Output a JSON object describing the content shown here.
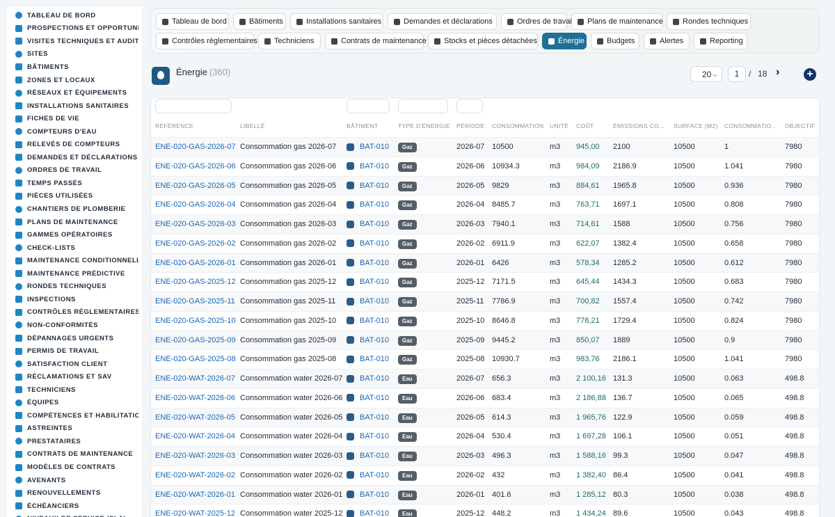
{
  "sidebar": {
    "items": [
      {
        "label": "TABLEAU DE BORD",
        "icon": "gauge-icon"
      },
      {
        "label": "PROSPECTIONS ET OPPORTUNITÉS",
        "icon": "target-icon"
      },
      {
        "label": "VISITES TECHNIQUES ET AUDITS",
        "icon": "clipboard-icon"
      },
      {
        "label": "SITES",
        "icon": "map-pin-icon"
      },
      {
        "label": "BÂTIMENTS",
        "icon": "building-icon"
      },
      {
        "label": "ZONES ET LOCAUX",
        "icon": "grid-icon"
      },
      {
        "label": "RÉSEAUX ET ÉQUIPEMENTS",
        "icon": "network-icon"
      },
      {
        "label": "INSTALLATIONS SANITAIRES",
        "icon": "pipes-icon"
      },
      {
        "label": "FICHES DE VIE",
        "icon": "history-icon"
      },
      {
        "label": "COMPTEURS D'EAU",
        "icon": "meter-icon"
      },
      {
        "label": "RELEVÉS DE COMPTEURS",
        "icon": "readings-icon"
      },
      {
        "label": "DEMANDES ET DÉCLARATIONS",
        "icon": "question-icon"
      },
      {
        "label": "ORDRES DE TRAVAIL",
        "icon": "work-order-icon"
      },
      {
        "label": "TEMPS PASSÉS",
        "icon": "clock-icon"
      },
      {
        "label": "PIÈCES UTILISÉES",
        "icon": "parts-icon"
      },
      {
        "label": "CHANTIERS DE PLOMBERIE",
        "icon": "wrench-icon"
      },
      {
        "label": "PLANS DE MAINTENANCE",
        "icon": "calendar-icon"
      },
      {
        "label": "GAMMES OPÉRATOIRES",
        "icon": "hierarchy-icon"
      },
      {
        "label": "CHECK-LISTS",
        "icon": "checklist-icon"
      },
      {
        "label": "MAINTENANCE CONDITIONNELLE",
        "icon": "thermometer-icon"
      },
      {
        "label": "MAINTENANCE PRÉDICTIVE",
        "icon": "chart-icon"
      },
      {
        "label": "RONDES TECHNIQUES",
        "icon": "route-icon"
      },
      {
        "label": "INSPECTIONS",
        "icon": "magnifier-icon"
      },
      {
        "label": "CONTRÔLES RÉGLEMENTAIRES",
        "icon": "shield-icon"
      },
      {
        "label": "NON-CONFORMITÉS",
        "icon": "alert-circle-icon"
      },
      {
        "label": "DÉPANNAGES URGENTS",
        "icon": "warning-icon"
      },
      {
        "label": "PERMIS DE TRAVAIL",
        "icon": "permit-icon"
      },
      {
        "label": "SATISFACTION CLIENT",
        "icon": "smile-icon"
      },
      {
        "label": "RÉCLAMATIONS ET SAV",
        "icon": "comment-icon"
      },
      {
        "label": "TECHNICIENS",
        "icon": "helmet-icon"
      },
      {
        "label": "ÉQUIPES",
        "icon": "users-icon"
      },
      {
        "label": "COMPÉTENCES ET HABILITATIONS",
        "icon": "certificate-icon"
      },
      {
        "label": "ASTREINTES",
        "icon": "phone-icon"
      },
      {
        "label": "PRESTATAIRES",
        "icon": "truck-icon"
      },
      {
        "label": "CONTRATS DE MAINTENANCE",
        "icon": "contract-icon"
      },
      {
        "label": "MODÈLES DE CONTRATS",
        "icon": "template-icon"
      },
      {
        "label": "AVENANTS",
        "icon": "edit-icon"
      },
      {
        "label": "RENOUVELLEMENTS",
        "icon": "refresh-icon"
      },
      {
        "label": "ÉCHÉANCIERS",
        "icon": "schedule-icon"
      },
      {
        "label": "NIVEAUX DE SERVICE (SLA)",
        "icon": "sla-icon"
      }
    ]
  },
  "topnav": {
    "row1": [
      {
        "label": "Tableau de bord",
        "icon": "gauge-icon"
      },
      {
        "label": "Bâtiments",
        "icon": "building-icon"
      },
      {
        "label": "Installations sanitaires",
        "icon": "pipes-icon"
      },
      {
        "label": "Demandes et déclarations",
        "icon": "question-icon"
      },
      {
        "label": "Ordres de travail",
        "icon": "work-order-icon"
      },
      {
        "label": "Plans de maintenance",
        "icon": "calendar-icon"
      },
      {
        "label": "Rondes techniques",
        "icon": "route-icon"
      }
    ],
    "row2": [
      {
        "label": "Contrôles réglementaires",
        "icon": "shield-icon"
      },
      {
        "label": "Techniciens",
        "icon": "helmet-icon"
      },
      {
        "label": "Contrats de maintenance",
        "icon": "contract-icon"
      },
      {
        "label": "Stocks et pièces détachées",
        "icon": "boxes-icon"
      },
      {
        "label": "Énergie",
        "icon": "bolt-icon",
        "active": true
      },
      {
        "label": "Budgets",
        "icon": "money-icon"
      },
      {
        "label": "Alertes",
        "icon": "bell-icon"
      },
      {
        "label": "Reporting",
        "icon": "pie-icon"
      }
    ]
  },
  "header": {
    "title": "Énergie",
    "count": "(360)",
    "page_size": "20",
    "current_page": "1",
    "separator": "/",
    "total_pages": "18",
    "next_icon": "chevron-right-icon",
    "add_icon": "plus-circle-icon"
  },
  "table": {
    "columns": [
      "RÉFÉRENCE",
      "LIBELLÉ",
      "BÂTIMENT",
      "TYPE D'ÉNERGIE",
      "PÉRIODE",
      "CONSOMMATION",
      "UNITÉ",
      "COÛT",
      "ÉMISSIONS CO...",
      "SURFACE (M2)",
      "CONSOMMATIO...",
      "OBJECTIF"
    ],
    "rows": [
      {
        "ref": "ENE-020-GAS-2026-07",
        "label": "Consommation gas 2026-07",
        "bat": "BAT-010",
        "type": "Gaz",
        "period": "2026-07",
        "conso": "10500",
        "unit": "m3",
        "cost": "945,00",
        "co2": "2100",
        "surface": "10500",
        "ratio": "1",
        "objective": "7980"
      },
      {
        "ref": "ENE-020-GAS-2026-06",
        "label": "Consommation gas 2026-06",
        "bat": "BAT-010",
        "type": "Gaz",
        "period": "2026-06",
        "conso": "10934.3",
        "unit": "m3",
        "cost": "984,09",
        "co2": "2186.9",
        "surface": "10500",
        "ratio": "1.041",
        "objective": "7980"
      },
      {
        "ref": "ENE-020-GAS-2026-05",
        "label": "Consommation gas 2026-05",
        "bat": "BAT-010",
        "type": "Gaz",
        "period": "2026-05",
        "conso": "9829",
        "unit": "m3",
        "cost": "884,61",
        "co2": "1965.8",
        "surface": "10500",
        "ratio": "0.936",
        "objective": "7980"
      },
      {
        "ref": "ENE-020-GAS-2026-04",
        "label": "Consommation gas 2026-04",
        "bat": "BAT-010",
        "type": "Gaz",
        "period": "2026-04",
        "conso": "8485.7",
        "unit": "m3",
        "cost": "763,71",
        "co2": "1697.1",
        "surface": "10500",
        "ratio": "0.808",
        "objective": "7980"
      },
      {
        "ref": "ENE-020-GAS-2026-03",
        "label": "Consommation gas 2026-03",
        "bat": "BAT-010",
        "type": "Gaz",
        "period": "2026-03",
        "conso": "7940.1",
        "unit": "m3",
        "cost": "714,61",
        "co2": "1588",
        "surface": "10500",
        "ratio": "0.756",
        "objective": "7980"
      },
      {
        "ref": "ENE-020-GAS-2026-02",
        "label": "Consommation gas 2026-02",
        "bat": "BAT-010",
        "type": "Gaz",
        "period": "2026-02",
        "conso": "6911.9",
        "unit": "m3",
        "cost": "622,07",
        "co2": "1382.4",
        "surface": "10500",
        "ratio": "0.658",
        "objective": "7980"
      },
      {
        "ref": "ENE-020-GAS-2026-01",
        "label": "Consommation gas 2026-01",
        "bat": "BAT-010",
        "type": "Gaz",
        "period": "2026-01",
        "conso": "6426",
        "unit": "m3",
        "cost": "578,34",
        "co2": "1285.2",
        "surface": "10500",
        "ratio": "0.612",
        "objective": "7980"
      },
      {
        "ref": "ENE-020-GAS-2025-12",
        "label": "Consommation gas 2025-12",
        "bat": "BAT-010",
        "type": "Gaz",
        "period": "2025-12",
        "conso": "7171.5",
        "unit": "m3",
        "cost": "645,44",
        "co2": "1434.3",
        "surface": "10500",
        "ratio": "0.683",
        "objective": "7980"
      },
      {
        "ref": "ENE-020-GAS-2025-11",
        "label": "Consommation gas 2025-11",
        "bat": "BAT-010",
        "type": "Gaz",
        "period": "2025-11",
        "conso": "7786.9",
        "unit": "m3",
        "cost": "700,82",
        "co2": "1557.4",
        "surface": "10500",
        "ratio": "0.742",
        "objective": "7980"
      },
      {
        "ref": "ENE-020-GAS-2025-10",
        "label": "Consommation gas 2025-10",
        "bat": "BAT-010",
        "type": "Gaz",
        "period": "2025-10",
        "conso": "8646.8",
        "unit": "m3",
        "cost": "778,21",
        "co2": "1729.4",
        "surface": "10500",
        "ratio": "0.824",
        "objective": "7980"
      },
      {
        "ref": "ENE-020-GAS-2025-09",
        "label": "Consommation gas 2025-09",
        "bat": "BAT-010",
        "type": "Gaz",
        "period": "2025-09",
        "conso": "9445.2",
        "unit": "m3",
        "cost": "850,07",
        "co2": "1889",
        "surface": "10500",
        "ratio": "0.9",
        "objective": "7980"
      },
      {
        "ref": "ENE-020-GAS-2025-08",
        "label": "Consommation gas 2025-08",
        "bat": "BAT-010",
        "type": "Gaz",
        "period": "2025-08",
        "conso": "10930.7",
        "unit": "m3",
        "cost": "983,76",
        "co2": "2186.1",
        "surface": "10500",
        "ratio": "1.041",
        "objective": "7980"
      },
      {
        "ref": "ENE-020-WAT-2026-07",
        "label": "Consommation water 2026-07",
        "bat": "BAT-010",
        "type": "Eau",
        "period": "2026-07",
        "conso": "656.3",
        "unit": "m3",
        "cost": "2 100,16",
        "co2": "131.3",
        "surface": "10500",
        "ratio": "0.063",
        "objective": "498.8"
      },
      {
        "ref": "ENE-020-WAT-2026-06",
        "label": "Consommation water 2026-06",
        "bat": "BAT-010",
        "type": "Eau",
        "period": "2026-06",
        "conso": "683.4",
        "unit": "m3",
        "cost": "2 186,88",
        "co2": "136.7",
        "surface": "10500",
        "ratio": "0.065",
        "objective": "498.8"
      },
      {
        "ref": "ENE-020-WAT-2026-05",
        "label": "Consommation water 2026-05",
        "bat": "BAT-010",
        "type": "Eau",
        "period": "2026-05",
        "conso": "614.3",
        "unit": "m3",
        "cost": "1 965,76",
        "co2": "122.9",
        "surface": "10500",
        "ratio": "0.059",
        "objective": "498.8"
      },
      {
        "ref": "ENE-020-WAT-2026-04",
        "label": "Consommation water 2026-04",
        "bat": "BAT-010",
        "type": "Eau",
        "period": "2026-04",
        "conso": "530.4",
        "unit": "m3",
        "cost": "1 697,28",
        "co2": "106.1",
        "surface": "10500",
        "ratio": "0.051",
        "objective": "498.8"
      },
      {
        "ref": "ENE-020-WAT-2026-03",
        "label": "Consommation water 2026-03",
        "bat": "BAT-010",
        "type": "Eau",
        "period": "2026-03",
        "conso": "496.3",
        "unit": "m3",
        "cost": "1 588,16",
        "co2": "99.3",
        "surface": "10500",
        "ratio": "0.047",
        "objective": "498.8"
      },
      {
        "ref": "ENE-020-WAT-2026-02",
        "label": "Consommation water 2026-02",
        "bat": "BAT-010",
        "type": "Eau",
        "period": "2026-02",
        "conso": "432",
        "unit": "m3",
        "cost": "1 382,40",
        "co2": "86.4",
        "surface": "10500",
        "ratio": "0.041",
        "objective": "498.8"
      },
      {
        "ref": "ENE-020-WAT-2026-01",
        "label": "Consommation water 2026-01",
        "bat": "BAT-010",
        "type": "Eau",
        "period": "2026-01",
        "conso": "401.6",
        "unit": "m3",
        "cost": "1 285,12",
        "co2": "80.3",
        "surface": "10500",
        "ratio": "0.038",
        "objective": "498.8"
      },
      {
        "ref": "ENE-020-WAT-2025-12",
        "label": "Consommation water 2025-12",
        "bat": "BAT-010",
        "type": "Eau",
        "period": "2025-12",
        "conso": "448.2",
        "unit": "m3",
        "cost": "1 434,24",
        "co2": "89.6",
        "surface": "10500",
        "ratio": "0.043",
        "objective": "498.8"
      }
    ]
  }
}
